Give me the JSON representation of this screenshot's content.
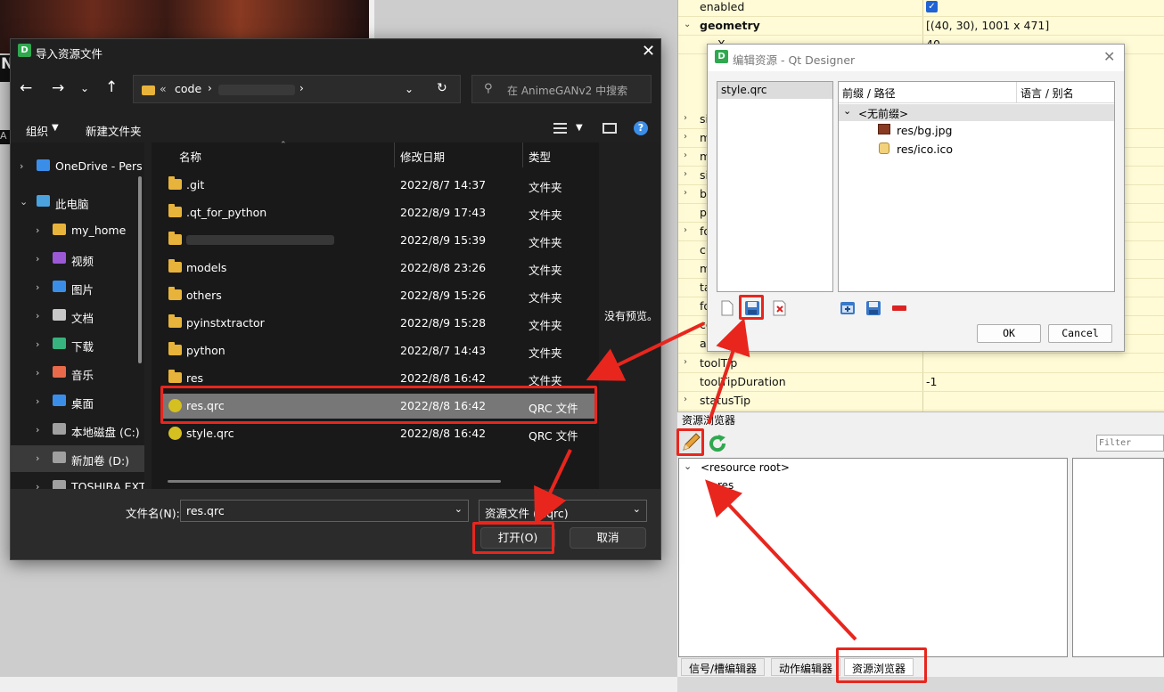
{
  "background": {
    "photo_letter": "N",
    "side_letter": "A"
  },
  "property_editor": {
    "rows": [
      {
        "name": "enabled",
        "value": "",
        "checked": true,
        "expandable": false,
        "bold": false
      },
      {
        "name": "geometry",
        "value": "[(40, 30), 1001 x 471]",
        "expandable": true,
        "bold": true
      },
      {
        "name": "X",
        "value": "40",
        "expandable": false,
        "bold": false
      }
    ],
    "partial_rows": [
      {
        "name": "si",
        "expandable": true
      },
      {
        "name": "m",
        "expandable": true
      },
      {
        "name": "m",
        "expandable": true
      },
      {
        "name": "si",
        "expandable": true
      },
      {
        "name": "b",
        "expandable": true
      },
      {
        "name": "p",
        "expandable": false
      },
      {
        "name": "fo",
        "expandable": true
      },
      {
        "name": "cu",
        "expandable": false
      },
      {
        "name": "m",
        "expandable": false
      },
      {
        "name": "ta",
        "expandable": false
      },
      {
        "name": "fo",
        "expandable": false
      },
      {
        "name": "co",
        "expandable": false
      },
      {
        "name": "ac",
        "expandable": false
      }
    ],
    "lower_rows": [
      {
        "name": "toolTip",
        "value": "",
        "expandable": true
      },
      {
        "name": "toolTipDuration",
        "value": "-1",
        "expandable": false
      },
      {
        "name": "statusTip",
        "value": "",
        "expandable": true
      }
    ]
  },
  "resource_browser": {
    "title": "资源浏览器",
    "filter_placeholder": "Filter",
    "tree_root": "<resource root>",
    "tree_child": "res",
    "tabs": [
      "信号/槽编辑器",
      "动作编辑器",
      "资源浏览器"
    ]
  },
  "qt_dialog": {
    "title": "编辑资源 - Qt Designer",
    "resource_files": [
      "style.qrc"
    ],
    "tree_headers": [
      "前缀 / 路径",
      "语言 / 别名"
    ],
    "prefix_node": "<无前缀>",
    "files": [
      "res/bg.jpg",
      "res/ico.ico"
    ],
    "ok_label": "OK",
    "cancel_label": "Cancel"
  },
  "file_dialog": {
    "title": "导入资源文件",
    "breadcrumb_prefix": "«",
    "breadcrumb_folder": "code",
    "search_placeholder": "在 AnimeGANv2 中搜索",
    "organize_label": "组织",
    "new_folder_label": "新建文件夹",
    "nav_items": [
      {
        "label": "OneDrive - Pers",
        "icon": "cloud-icon",
        "color": "#3b8ee8",
        "indent": 0,
        "expanded": false
      },
      {
        "label": "此电脑",
        "icon": "computer-icon",
        "color": "#4aa3df",
        "indent": 0,
        "expanded": true
      },
      {
        "label": "my_home",
        "icon": "folder-icon",
        "color": "#e8b33a",
        "indent": 1,
        "expanded": false
      },
      {
        "label": "视频",
        "icon": "video-icon",
        "color": "#9b59d6",
        "indent": 1,
        "expanded": false
      },
      {
        "label": "图片",
        "icon": "picture-icon",
        "color": "#3b8ee8",
        "indent": 1,
        "expanded": false
      },
      {
        "label": "文档",
        "icon": "document-icon",
        "color": "#c8c8c8",
        "indent": 1,
        "expanded": false
      },
      {
        "label": "下载",
        "icon": "download-icon",
        "color": "#36b37e",
        "indent": 1,
        "expanded": false
      },
      {
        "label": "音乐",
        "icon": "music-icon",
        "color": "#e86a4a",
        "indent": 1,
        "expanded": false
      },
      {
        "label": "桌面",
        "icon": "desktop-icon",
        "color": "#3b8ee8",
        "indent": 1,
        "expanded": false
      },
      {
        "label": "本地磁盘 (C:)",
        "icon": "drive-icon",
        "color": "#a0a0a0",
        "indent": 1,
        "expanded": false
      },
      {
        "label": "新加卷 (D:)",
        "icon": "drive-icon",
        "color": "#a0a0a0",
        "indent": 1,
        "expanded": false,
        "selected": true
      },
      {
        "label": "TOSHIBA EXT",
        "icon": "drive-icon",
        "color": "#a0a0a0",
        "indent": 1,
        "expanded": false
      }
    ],
    "columns": [
      "名称",
      "修改日期",
      "类型"
    ],
    "files": [
      {
        "name": ".git",
        "date": "2022/8/7 14:37",
        "type": "文件夹",
        "kind": "folder"
      },
      {
        "name": ".qt_for_python",
        "date": "2022/8/9 17:43",
        "type": "文件夹",
        "kind": "folder"
      },
      {
        "name": "",
        "date": "2022/8/9 15:39",
        "type": "文件夹",
        "kind": "folder",
        "blurred": true
      },
      {
        "name": "models",
        "date": "2022/8/8 23:26",
        "type": "文件夹",
        "kind": "folder"
      },
      {
        "name": "others",
        "date": "2022/8/9 15:26",
        "type": "文件夹",
        "kind": "folder"
      },
      {
        "name": "pyinstxtractor",
        "date": "2022/8/9 15:28",
        "type": "文件夹",
        "kind": "folder"
      },
      {
        "name": "python",
        "date": "2022/8/7 14:43",
        "type": "文件夹",
        "kind": "folder"
      },
      {
        "name": "res",
        "date": "2022/8/8 16:42",
        "type": "文件夹",
        "kind": "folder"
      },
      {
        "name": "res.qrc",
        "date": "2022/8/8 16:42",
        "type": "QRC 文件",
        "kind": "qrc",
        "selected": true
      },
      {
        "name": "style.qrc",
        "date": "2022/8/8 16:42",
        "type": "QRC 文件",
        "kind": "qrc"
      }
    ],
    "preview_text": "没有预览。",
    "filename_label": "文件名(N):",
    "filename_value": "res.qrc",
    "filetype_value": "资源文件 (*.qrc)",
    "open_label": "打开(O)",
    "cancel_label": "取消"
  },
  "colors": {
    "annotation_red": "#e8261e",
    "qt_green": "#2fa84f"
  }
}
